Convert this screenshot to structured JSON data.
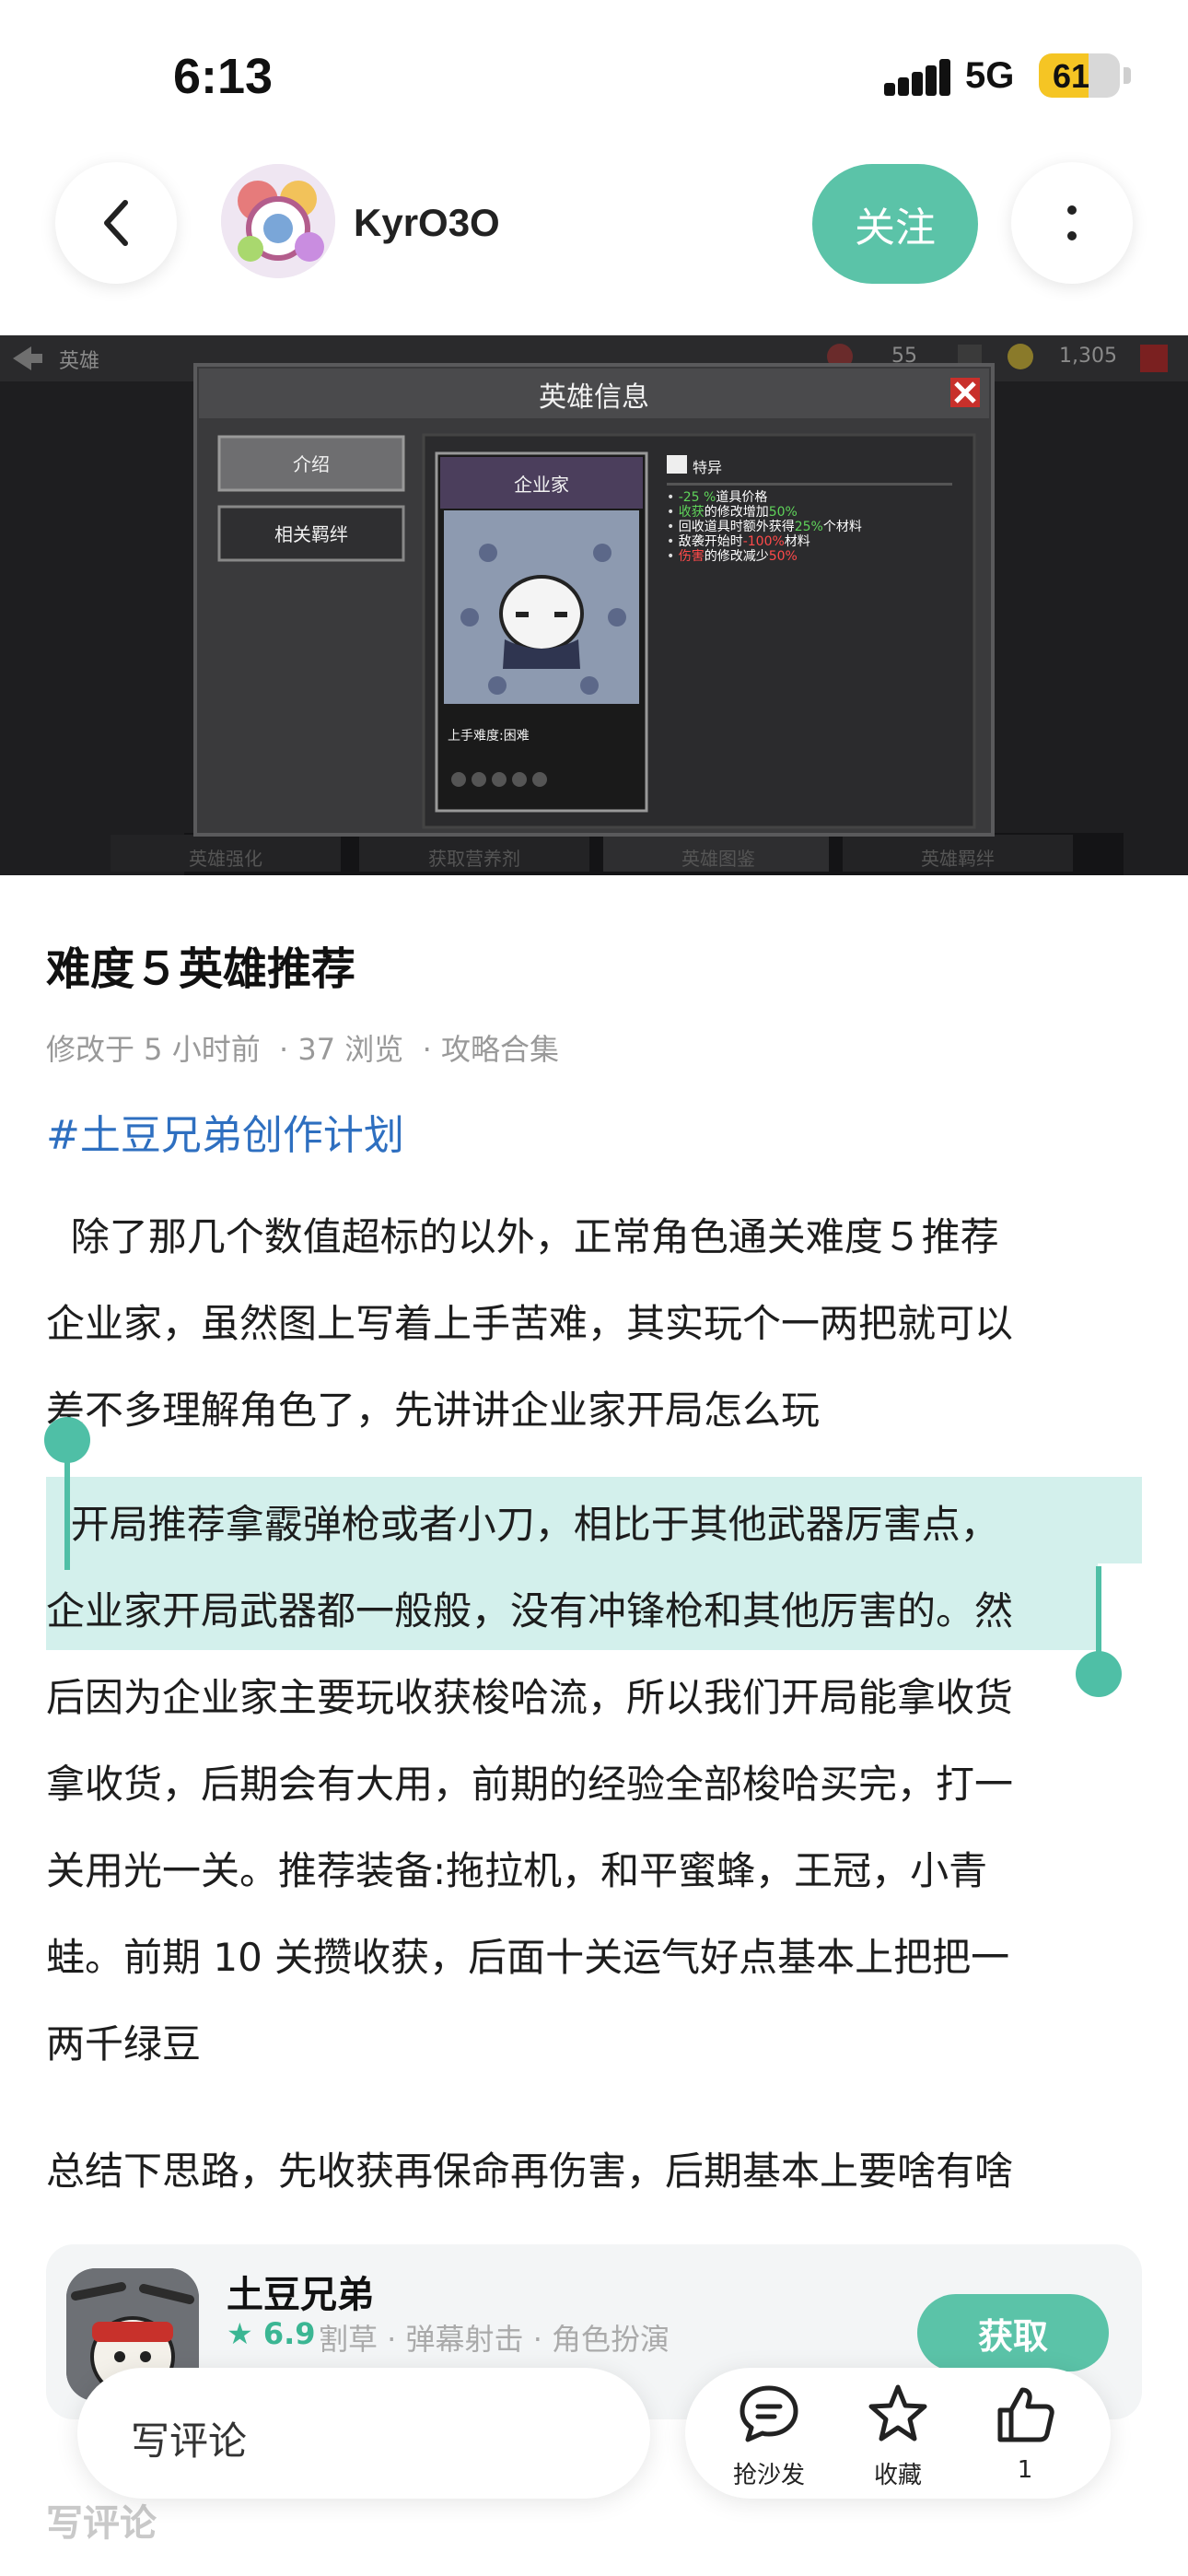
{
  "status_bar": {
    "time": "6:13",
    "network": "5G",
    "battery": "61",
    "battery_level": 0.61
  },
  "header": {
    "username": "KyrO3O",
    "follow_label": "关注"
  },
  "game_screenshot": {
    "top_left": "英雄",
    "stat_left": "55",
    "stat_right": "1,305",
    "dialog_title": "英雄信息",
    "tab_intro": "介绍",
    "tab_bonds": "相关羁绊",
    "hero_name": "企业家",
    "difficulty": "上手难度:困难",
    "traits_title": "特异",
    "traits": [
      {
        "parts": [
          {
            "t": "-25 %",
            "c": "#5fd35a"
          },
          {
            "t": "道具价格",
            "c": "#ffffff"
          }
        ]
      },
      {
        "parts": [
          {
            "t": "收获",
            "c": "#5fd35a"
          },
          {
            "t": "的修改增加",
            "c": "#ffffff"
          },
          {
            "t": "50%",
            "c": "#5fd35a"
          }
        ]
      },
      {
        "parts": [
          {
            "t": "回收道具时额外获得",
            "c": "#ffffff"
          },
          {
            "t": "25%",
            "c": "#5fd35a"
          },
          {
            "t": "个材料",
            "c": "#ffffff"
          }
        ]
      },
      {
        "parts": [
          {
            "t": "敌袭开始时",
            "c": "#ffffff"
          },
          {
            "t": "-100%",
            "c": "#ff4a4a"
          },
          {
            "t": "材料",
            "c": "#ffffff"
          }
        ]
      },
      {
        "parts": [
          {
            "t": "伤害",
            "c": "#ff4a4a"
          },
          {
            "t": "的修改减少",
            "c": "#ffffff"
          },
          {
            "t": "50%",
            "c": "#ff4a4a"
          }
        ]
      }
    ],
    "bottom_tabs": [
      "英雄强化",
      "获取营养剂",
      "英雄图鉴",
      "英雄羁绊"
    ]
  },
  "article": {
    "title": "难度５英雄推荐",
    "meta": "修改于 5 小时前  · 37 浏览  · 攻略合集",
    "hashtag": "#土豆兄弟创作计划",
    "p1_lines": [
      "  除了那几个数值超标的以外，正常角色通关难度５推荐",
      "企业家，虽然图上写着上手苦难，其实玩个一两把就可以",
      "差不多理解角色了，先讲讲企业家开局怎么玩"
    ],
    "p2_line1": "  开局推荐拿霰弹枪或者小刀，相比于其他武器厉害点，",
    "p2_line2_hl": "企业家开局武器都一般般，没有冲锋枪和其他厉害的。",
    "p2_line2_rest": "然",
    "p2_lines_rest": [
      "后因为企业家主要玩收获梭哈流，所以我们开局能拿收货",
      "拿收货，后期会有大用，前期的经验全部梭哈买完，打一",
      "关用光一关。推荐装备:拖拉机，和平蜜蜂，王冠，小青",
      "蛙。前期 10 关攒收获，后面十关运气好点基本上把把一",
      "两千绿豆"
    ],
    "p3": "总结下思路，先收获再保命再伤害，后期基本上要啥有啥"
  },
  "app_card": {
    "name": "土豆兄弟",
    "rating": "★ 6.9",
    "tags": "割草 · 弹幕射击 · 角色扮演",
    "get_label": "获取"
  },
  "bottom_bar": {
    "comment_placeholder": "写评论",
    "sofa_label": "抢沙发",
    "favorite_label": "收藏",
    "like_count": "1",
    "ghost_label": "写评论"
  }
}
